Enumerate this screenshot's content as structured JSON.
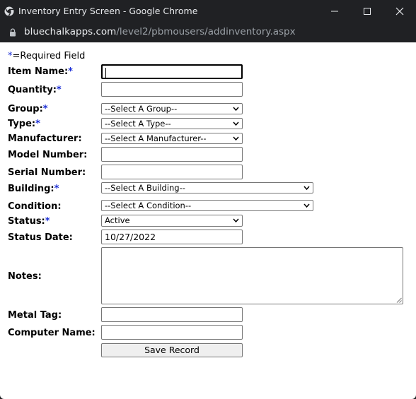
{
  "window": {
    "title": "Inventory Entry Screen - Google Chrome",
    "url_host": "bluechalkapps.com",
    "url_path": "/level2/pbmousers/addinventory.aspx"
  },
  "form": {
    "required_star": "*",
    "required_note": "=Required Field",
    "fields": {
      "item_name": {
        "label": "Item Name:",
        "required": true,
        "value": ""
      },
      "quantity": {
        "label": "Quantity:",
        "required": true,
        "value": ""
      },
      "group": {
        "label": "Group:",
        "required": true,
        "selected": "--Select A Group--"
      },
      "type": {
        "label": "Type:",
        "required": true,
        "selected": "--Select A Type--"
      },
      "manufacturer": {
        "label": "Manufacturer:",
        "required": false,
        "selected": "--Select A Manufacturer--"
      },
      "model_number": {
        "label": "Model Number:",
        "required": false,
        "value": ""
      },
      "serial_number": {
        "label": "Serial Number:",
        "required": false,
        "value": ""
      },
      "building": {
        "label": "Building:",
        "required": true,
        "selected": "--Select A Building--"
      },
      "condition": {
        "label": "Condition:",
        "required": false,
        "selected": "--Select A Condition--"
      },
      "status": {
        "label": "Status:",
        "required": true,
        "selected": "Active"
      },
      "status_date": {
        "label": "Status Date:",
        "required": false,
        "value": "10/27/2022"
      },
      "notes": {
        "label": "Notes:",
        "required": false,
        "value": ""
      },
      "metal_tag": {
        "label": "Metal Tag:",
        "required": false,
        "value": ""
      },
      "computer_name": {
        "label": "Computer Name:",
        "required": false,
        "value": ""
      }
    },
    "save_label": "Save Record"
  },
  "colors": {
    "required_star": "#1c2fd6",
    "titlebar_bg": "#202124"
  },
  "icons": {
    "browser": "chrome-icon",
    "lock": "lock-icon",
    "minimize": "minimize-icon",
    "maximize": "maximize-icon",
    "close": "close-icon"
  }
}
